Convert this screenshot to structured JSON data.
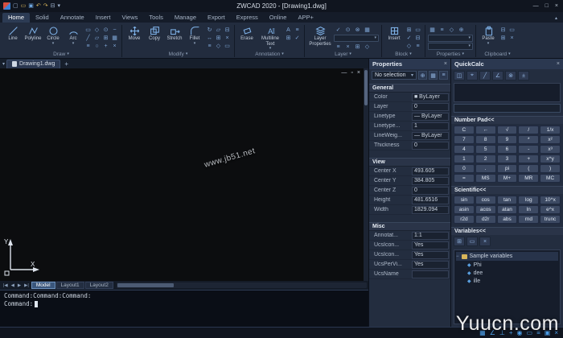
{
  "titlebar": {
    "title": "ZWCAD 2020 - [Drawing1.dwg]",
    "qat_icons": [
      "▢",
      "▭",
      "▣",
      "↶",
      "↷",
      "⊟",
      "▾"
    ]
  },
  "win": [
    "—",
    "□",
    "×"
  ],
  "ui": {
    "chev_down": "▾",
    "chev_up": "▴",
    "close": "×",
    "plus": "+",
    "nav": [
      "|◀",
      "◀",
      "▶",
      "▶|"
    ],
    "mtext_glyph": "A"
  },
  "ribbon_tabs": [
    "Home",
    "Solid",
    "Annotate",
    "Insert",
    "Views",
    "Tools",
    "Manage",
    "Export",
    "Express",
    "Online",
    "APP+"
  ],
  "panels": {
    "draw": {
      "label": "Draw",
      "line": "Line",
      "polyline": "Polyline",
      "circle": "Circle",
      "arc": "Arc",
      "minis": [
        "▭",
        "◇",
        "⊙",
        "~",
        "╱",
        "▱",
        "⊞",
        "▦",
        "≡",
        "○",
        "+",
        "×"
      ]
    },
    "modify": {
      "label": "Modify",
      "move": "Move",
      "copy": "Copy",
      "stretch": "Stretch",
      "fillet": "Fillet",
      "minis": [
        "↻",
        "▱",
        "⊟",
        "↔",
        "⊞",
        "×",
        "≡",
        "◇",
        "▭"
      ]
    },
    "annotation": {
      "label": "Annotation",
      "erase": "Erase",
      "mtext": "Multiline Text",
      "minis": [
        "A",
        "≡",
        "⊞",
        "✓"
      ]
    },
    "layer": {
      "label": "Layer",
      "layer_props": "Layer Properties",
      "minis_top": [
        "✓",
        "⊙",
        "⊗",
        "▦"
      ],
      "minis_bottom": [
        "≡",
        "×",
        "⊞",
        "◇"
      ]
    },
    "block": {
      "label": "Block",
      "insert": "Insert",
      "minis": [
        "⊞",
        "▭",
        "✓",
        "⊟",
        "◇",
        "≡"
      ]
    },
    "properties": {
      "label": "Properties",
      "minis": [
        "▦",
        "≡",
        "◇",
        "⊕"
      ]
    },
    "clipboard": {
      "label": "Clipboard",
      "paste": "Paste",
      "minis": [
        "⊟",
        "▭",
        "⊞",
        "×"
      ]
    }
  },
  "docbar": {
    "tab": "Drawing1.dwg"
  },
  "canvas": {
    "watermark": "www.jb51.net",
    "axis_x": "X",
    "axis_y": "Y",
    "controls": [
      "—",
      "▫",
      "×"
    ]
  },
  "layout_tabs": [
    "Model",
    "Layout1",
    "Layout2"
  ],
  "command": {
    "lines": [
      "Command:",
      "Command:",
      "Command:"
    ],
    "active": "Command:"
  },
  "props_panel": {
    "title": "Properties",
    "selection": "No selection",
    "combo_icons": [
      "⊕",
      "▦",
      "≡"
    ],
    "general_label": "General",
    "general": [
      {
        "k": "Color",
        "v": "■ ByLayer"
      },
      {
        "k": "Layer",
        "v": "0"
      },
      {
        "k": "Linetype",
        "v": "— ByLayer"
      },
      {
        "k": "Linetype...",
        "v": "1"
      },
      {
        "k": "LineWeig...",
        "v": "— ByLayer"
      },
      {
        "k": "Thickness",
        "v": "0"
      }
    ],
    "view_label": "View",
    "view": [
      {
        "k": "Center X",
        "v": "493.605"
      },
      {
        "k": "Center Y",
        "v": "384.805"
      },
      {
        "k": "Center Z",
        "v": "0"
      },
      {
        "k": "Height",
        "v": "481.6516"
      },
      {
        "k": "Width",
        "v": "1829.094"
      }
    ],
    "misc_label": "Misc",
    "misc": [
      {
        "k": "Annotat...",
        "v": "1:1"
      },
      {
        "k": "UcsIcon...",
        "v": "Yes"
      },
      {
        "k": "UcsIcon...",
        "v": "Yes"
      },
      {
        "k": "UcsPerVi...",
        "v": "Yes"
      },
      {
        "k": "UcsName",
        "v": ""
      }
    ]
  },
  "quickcalc": {
    "title": "QuickCalc",
    "toolbar_icons": [
      "◫",
      "⌖",
      "╱",
      "∠",
      "⊗",
      "±"
    ],
    "numpad_label": "Number Pad<<",
    "numpad": [
      "C",
      "←",
      "√",
      "/",
      "1/x",
      "7",
      "8",
      "9",
      "*",
      "x²",
      "4",
      "5",
      "6",
      "-",
      "x³",
      "1",
      "2",
      "3",
      "+",
      "x^y",
      "0",
      ".",
      "pi",
      "(",
      ")",
      "=",
      "MS",
      "M+",
      "MR",
      "MC"
    ],
    "sci_label": "Scientific<<",
    "sci": [
      "sin",
      "cos",
      "tan",
      "log",
      "10^x",
      "asin",
      "acos",
      "atan",
      "ln",
      "e^x",
      "r2d",
      "d2r",
      "abs",
      "rnd",
      "trunc"
    ],
    "vars_label": "Variables<<",
    "vars_toolbar": [
      "⊞",
      "▭",
      "×"
    ],
    "tree_root": "Sample variables",
    "vars": [
      "Phi",
      "dee",
      "ille"
    ]
  },
  "status_icons": [
    "▦",
    "∠",
    "⊥",
    "+",
    "◉",
    "▭",
    "≡",
    "▣",
    "×"
  ],
  "watermark": "Yuucn.com"
}
